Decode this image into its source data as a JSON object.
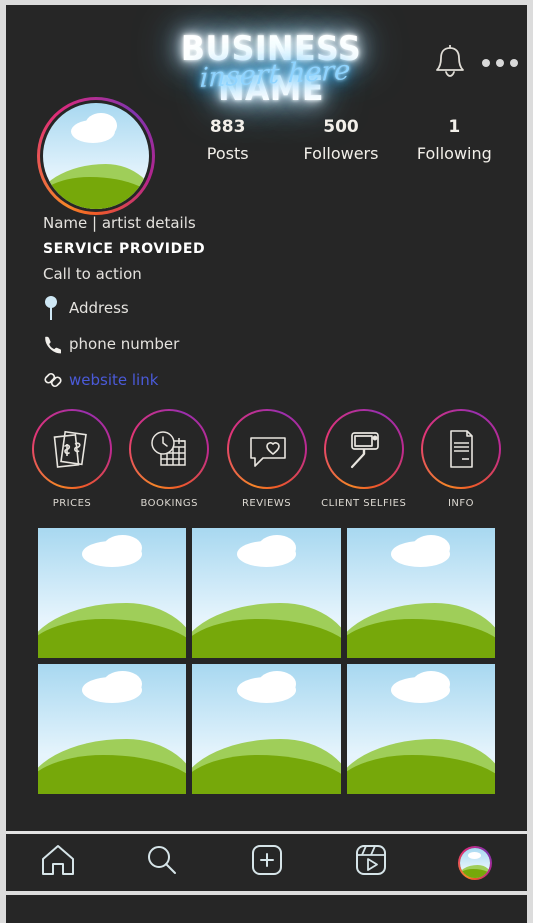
{
  "header": {
    "business_name": "BUSINESS NAME",
    "script_text": "insert here",
    "bell_icon": "bell-icon",
    "menu_icon": "more-options-icon"
  },
  "profile": {
    "avatar_alt": "profile-photo-placeholder",
    "stats": [
      {
        "number": "883",
        "label": "Posts"
      },
      {
        "number": "500",
        "label": "Followers"
      },
      {
        "number": "1",
        "label": "Following"
      }
    ]
  },
  "bio": {
    "name_line": "Name | artist details",
    "service": "SERVICE PROVIDED",
    "call_to_action": "Call to action",
    "address": "Address",
    "phone": "phone number",
    "website": "website link",
    "address_icon": "location-pin-icon",
    "phone_icon": "phone-icon",
    "link_icon": "link-icon"
  },
  "highlights": [
    {
      "label": "PRICES",
      "icon": "money-bills-icon"
    },
    {
      "label": "BOOKINGS",
      "icon": "clock-calendar-icon"
    },
    {
      "label": "REVIEWS",
      "icon": "speech-bubble-heart-icon"
    },
    {
      "label": "CLIENT SELFIES",
      "icon": "selfie-stick-icon"
    },
    {
      "label": "INFO",
      "icon": "document-icon"
    }
  ],
  "grid": {
    "posts": [
      {
        "alt": "post-placeholder-1"
      },
      {
        "alt": "post-placeholder-2"
      },
      {
        "alt": "post-placeholder-3"
      },
      {
        "alt": "post-placeholder-4"
      },
      {
        "alt": "post-placeholder-5"
      },
      {
        "alt": "post-placeholder-6"
      }
    ]
  },
  "navbar": {
    "items": [
      {
        "icon": "home-icon",
        "label": "Home"
      },
      {
        "icon": "search-icon",
        "label": "Search"
      },
      {
        "icon": "add-post-icon",
        "label": "Create"
      },
      {
        "icon": "reels-icon",
        "label": "Reels"
      },
      {
        "icon": "profile-avatar-icon",
        "label": "Profile"
      }
    ]
  },
  "colors": {
    "background": "#262626",
    "page_border": "#dcdcdc",
    "neon_white": "#ffffff",
    "neon_cyan": "#8fd4ff",
    "link_blue": "#4a5ad8",
    "gradient_orange": "#f58529",
    "gradient_pink": "#dd2a7b",
    "gradient_purple": "#8134af",
    "sky": "#a8d8f0",
    "hill_light": "#9fce59",
    "hill_dark": "#76a80a"
  }
}
